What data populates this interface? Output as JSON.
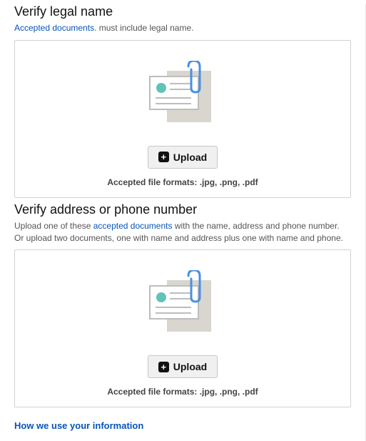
{
  "section1": {
    "title": "Verify legal name",
    "link_text": "Accepted documents",
    "text_after": ". must include legal name.",
    "upload_label": "Upload",
    "formats_text": "Accepted file formats: .jpg, .png, .pdf"
  },
  "section2": {
    "title": "Verify address or phone number",
    "text_before": "Upload one of these ",
    "link_text": "accepted documents",
    "text_after": " with the name, address and phone number. Or upload two documents, one with name and address plus one with name and phone.",
    "upload_label": "Upload",
    "formats_text": "Accepted file formats: .jpg, .png, .pdf"
  },
  "footer": {
    "info_link": "How we use your information"
  }
}
